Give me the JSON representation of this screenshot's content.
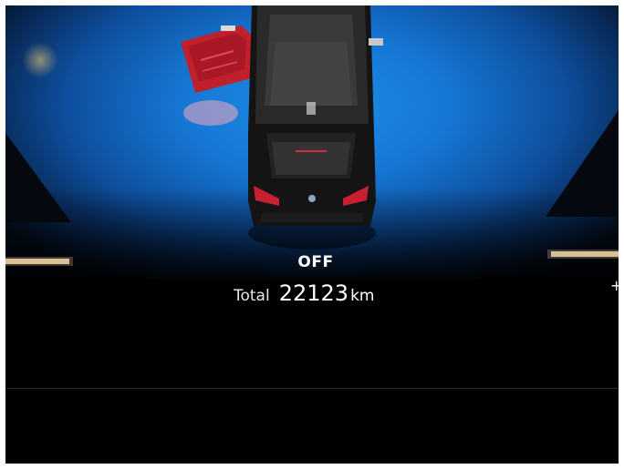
{
  "display": {
    "status": "OFF",
    "odometer": {
      "label": "Total",
      "value": "22123",
      "unit": "km"
    },
    "plus_symbol": "+"
  },
  "vehicle": {
    "icon": "car-top-view-icon",
    "door_icon": "open-door-warning-icon",
    "door_state": "open",
    "door_color": "#c01f2c"
  },
  "colors": {
    "background": "#000000",
    "accent_blue": "#1677d4",
    "warning_red": "#c01f2c",
    "text": "#ffffff"
  }
}
